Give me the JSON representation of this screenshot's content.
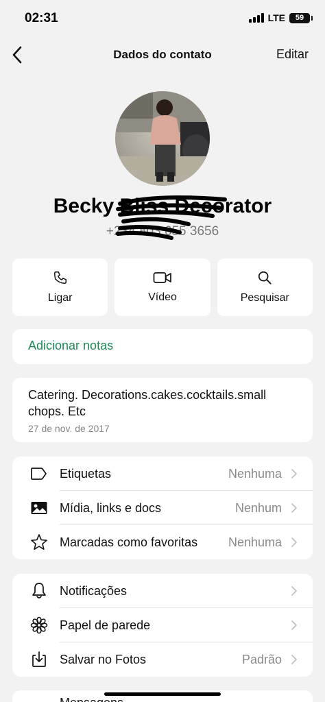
{
  "status_bar": {
    "time": "02:31",
    "network": "LTE",
    "battery": "59"
  },
  "nav": {
    "title": "Dados do contato",
    "edit_label": "Editar"
  },
  "contact": {
    "name": "Becky Bliss Decorator",
    "phone": "+234 803 655 3656"
  },
  "actions": [
    {
      "label": "Ligar",
      "icon": "phone-icon"
    },
    {
      "label": "Vídeo",
      "icon": "video-icon"
    },
    {
      "label": "Pesquisar",
      "icon": "search-icon"
    }
  ],
  "notes": {
    "label": "Adicionar notas"
  },
  "about": {
    "text": "Catering. Decorations.cakes.cocktails.small chops. Etc",
    "date": "27 de nov. de 2017"
  },
  "section1": [
    {
      "label": "Etiquetas",
      "value": "Nenhuma",
      "icon": "label-icon"
    },
    {
      "label": "Mídia, links e docs",
      "value": "Nenhum",
      "icon": "image-icon"
    },
    {
      "label": "Marcadas como favoritas",
      "value": "Nenhuma",
      "icon": "star-icon"
    }
  ],
  "section2": [
    {
      "label": "Notificações",
      "value": "",
      "icon": "bell-icon"
    },
    {
      "label": "Papel de parede",
      "value": "",
      "icon": "flower-icon"
    },
    {
      "label": "Salvar no Fotos",
      "value": "Padrão",
      "icon": "download-icon"
    }
  ],
  "section3": {
    "partial_label": "Mensagens"
  },
  "colors": {
    "accent_green": "#1d8a56",
    "background": "#f2f2f2"
  }
}
